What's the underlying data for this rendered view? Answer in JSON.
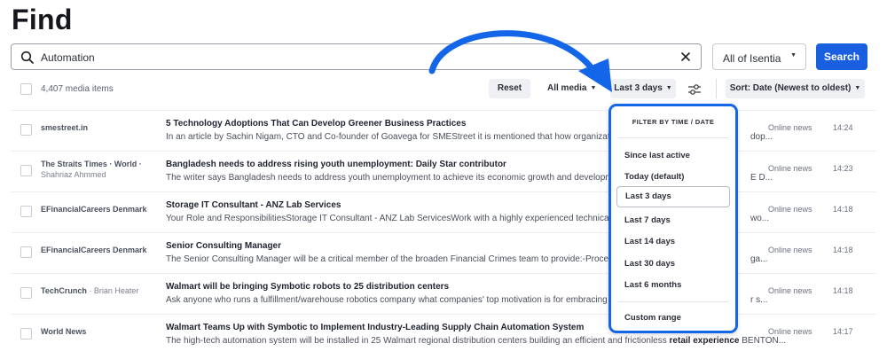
{
  "page": {
    "title": "Find"
  },
  "search": {
    "query": "Automation",
    "scope": "All of Isentia",
    "button_label": "Search",
    "icons": {
      "search": "search-icon",
      "clear": "close-icon",
      "scope_caret": "caret-down-icon"
    }
  },
  "toolbar": {
    "count_label": "4,407 media items",
    "reset_label": "Reset",
    "media_filter_label": "All media",
    "time_filter_label": "Last 3 days",
    "filter_icon": "sliders-icon",
    "sort_label": "Sort: Date (Newest to oldest)"
  },
  "results": [
    {
      "source": "smestreet.in",
      "author": "",
      "headline": "5 Technology Adoptions That Can Develop Greener Business Practices",
      "snippet": "In an article by Sachin Nigam, CTO and Co-founder of Goavega for SMEStreet it is mentioned that how organizations ca",
      "snippet_end": "dop...",
      "media_type": "Online news",
      "time": "14:24"
    },
    {
      "source": "The Straits Times · World ·",
      "author": "Shahriaz Ahmmed",
      "headline": "Bangladesh needs to address rising youth unemployment: Daily Star contributor",
      "snippet": "The writer says Bangladesh needs to address youth unemployment to achieve its economic growth and development g",
      "snippet_end": "E D...",
      "media_type": "Online news",
      "time": "14:23"
    },
    {
      "source": "EFinancialCareers Denmark",
      "author": "",
      "headline": "Storage IT Consultant - ANZ Lab Services",
      "snippet": "Your Role and ResponsibilitiesStorage IT Consultant - ANZ Lab ServicesWork with a highly experienced technical team M",
      "snippet_end": "wo...",
      "media_type": "Online news",
      "time": "14:18"
    },
    {
      "source": "EFinancialCareers Denmark",
      "author": "",
      "headline": "Senior Consulting Manager",
      "snippet": "The Senior Consulting Manager will be a critical member of the broaden Financial Crimes team to provide:-Process re-c",
      "snippet_end": "ga...",
      "media_type": "Online news",
      "time": "14:18"
    },
    {
      "source": "TechCrunch",
      "author": "· Brian Heater",
      "headline": "Walmart will be bringing Symbotic robots to 25 distribution centers",
      "snippet": "Ask anyone who runs a fulfillment/warehouse robotics company what companies' top motivation is for embracing auto",
      "snippet_end": "r s...",
      "media_type": "Online news",
      "time": "14:18"
    },
    {
      "source": "World News",
      "author": "",
      "headline": "Walmart Teams Up with Symbotic to Implement Industry-Leading Supply Chain Automation System",
      "snippet": "The high-tech automation system will be installed in 25 Walmart regional distribution centers building an efficient and frictionless",
      "snippet_bold": "retail experience",
      "snippet_end": "BENTON...",
      "media_type": "Online news",
      "time": "14:17"
    }
  ],
  "time_dropdown": {
    "header": "FILTER BY TIME / DATE",
    "options": [
      "Since last active",
      "Today (default)",
      "Last 3 days",
      "Last 7 days",
      "Last 14 days",
      "Last 30 days",
      "Last 6 months"
    ],
    "selected": "Last 3 days",
    "custom_label": "Custom range"
  },
  "colors": {
    "accent": "#1a5fe0",
    "highlight": "#1466e8"
  }
}
